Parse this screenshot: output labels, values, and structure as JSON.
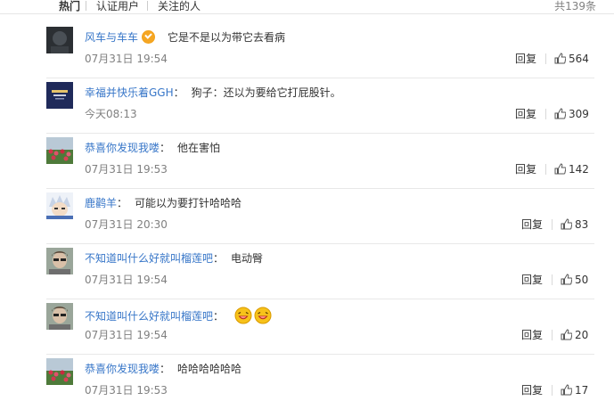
{
  "tabs": [
    {
      "label": "热门"
    },
    {
      "label": "认证用户"
    },
    {
      "label": "关注的人"
    }
  ],
  "total_count": "共139条",
  "reply_label": "回复",
  "comments": [
    {
      "username": "风车与车车",
      "verified": true,
      "text": "它是不是以为带它去看病",
      "time": "07月31日 19:54",
      "likes": "564"
    },
    {
      "username": "幸福并快乐着GGH",
      "verified": false,
      "text": "狗子：还以为要给它打屁股针。",
      "time": "今天08:13",
      "likes": "309"
    },
    {
      "username": "恭喜你发现我喽",
      "verified": false,
      "text": "他在害怕",
      "time": "07月31日 19:53",
      "likes": "142"
    },
    {
      "username": "鹿鹳羊",
      "verified": false,
      "text": "可能以为要打针哈哈哈",
      "time": "07月31日 20:30",
      "likes": "83"
    },
    {
      "username": "不知道叫什么好就叫榴莲吧",
      "verified": false,
      "text": "电动臀",
      "time": "07月31日 19:54",
      "likes": "50"
    },
    {
      "username": "不知道叫什么好就叫榴莲吧",
      "verified": false,
      "text": "",
      "emoji": "laughing-emoji",
      "time": "07月31日 19:54",
      "likes": "20"
    },
    {
      "username": "恭喜你发现我喽",
      "verified": false,
      "text": "哈哈哈哈哈哈",
      "time": "07月31日 19:53",
      "likes": "17"
    }
  ],
  "colors": {
    "username": "#3776c8",
    "meta": "#808080",
    "divider": "#e8e8e8",
    "verified_badge": "#f5a623"
  }
}
